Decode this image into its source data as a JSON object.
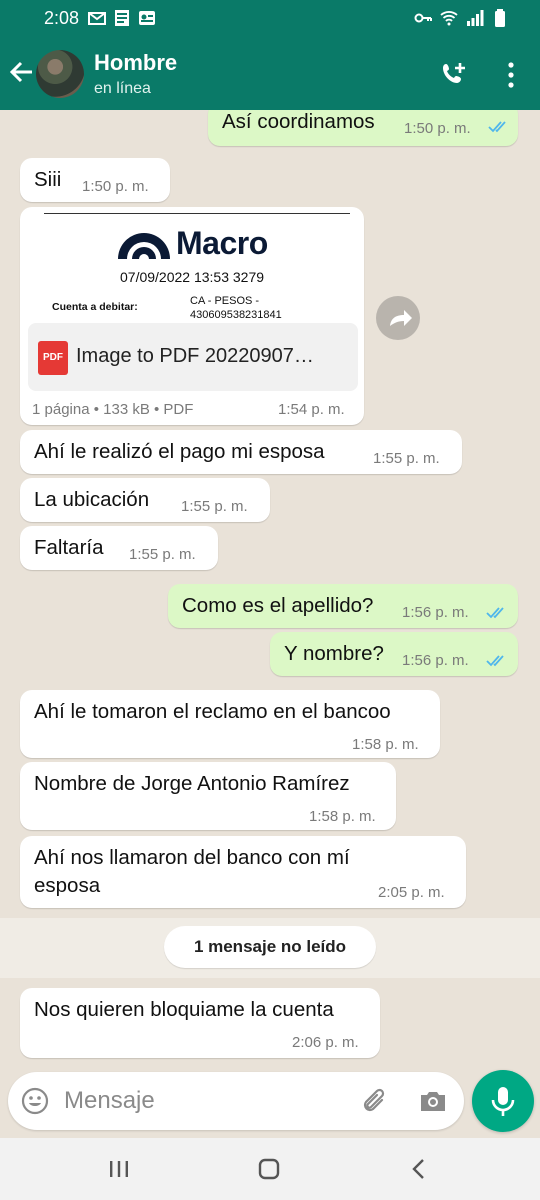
{
  "status_bar": {
    "time": "2:08",
    "left_icons": [
      "gmail-icon",
      "document-icon",
      "sim-contact-icon"
    ],
    "right_icons": [
      "vpn-key-icon",
      "wifi-calling-icon",
      "signal-icon",
      "battery-icon"
    ]
  },
  "header": {
    "contact_name": "Hombre",
    "contact_status": "en línea",
    "color": "#0a7a68"
  },
  "messages": [
    {
      "dir": "out",
      "text": "Así coordinamos",
      "time": "1:50 p. m.",
      "read": true
    },
    {
      "dir": "in",
      "text": "Siii",
      "time": "1:50 p. m."
    },
    {
      "dir": "in",
      "type": "document",
      "preview": {
        "brand": "Macro",
        "dateline": "07/09/2022 13:53 3279",
        "account_label": "Cuenta a debitar:",
        "account_type": "CA - PESOS -",
        "account_number": "430609538231841"
      },
      "file_badge": "PDF",
      "file_name": "Image to PDF 20220907…",
      "meta": "1 página • 133 kB • PDF",
      "time": "1:54 p. m."
    },
    {
      "dir": "in",
      "text": "Ahí le realizó el pago mi esposa",
      "time": "1:55 p. m."
    },
    {
      "dir": "in",
      "text": "La ubicación",
      "time": "1:55 p. m."
    },
    {
      "dir": "in",
      "text": "Faltaría",
      "time": "1:55 p. m."
    },
    {
      "dir": "out",
      "text": "Como es el apellido?",
      "time": "1:56 p. m.",
      "read": true
    },
    {
      "dir": "out",
      "text": "Y nombre?",
      "time": "1:56 p. m.",
      "read": true
    },
    {
      "dir": "in",
      "text": "Ahí le tomaron el reclamo en el bancoo",
      "time": "1:58 p. m."
    },
    {
      "dir": "in",
      "text": "Nombre de Jorge Antonio Ramírez",
      "time": "1:58 p. m."
    },
    {
      "dir": "in",
      "text_line1": "Ahí nos llamaron del banco con mí",
      "text_line2": "esposa",
      "time": "2:05 p. m."
    },
    {
      "dir": "in",
      "text": "Nos quieren bloquiame la cuenta",
      "time": "2:06 p. m."
    }
  ],
  "unread_banner": "1 mensaje no leído",
  "composer": {
    "placeholder": "Mensaje"
  },
  "colors": {
    "outgoing_bubble": "#dcf8c6",
    "incoming_bubble": "#ffffff",
    "read_ticks": "#4fb6ec",
    "accent": "#00a884"
  }
}
